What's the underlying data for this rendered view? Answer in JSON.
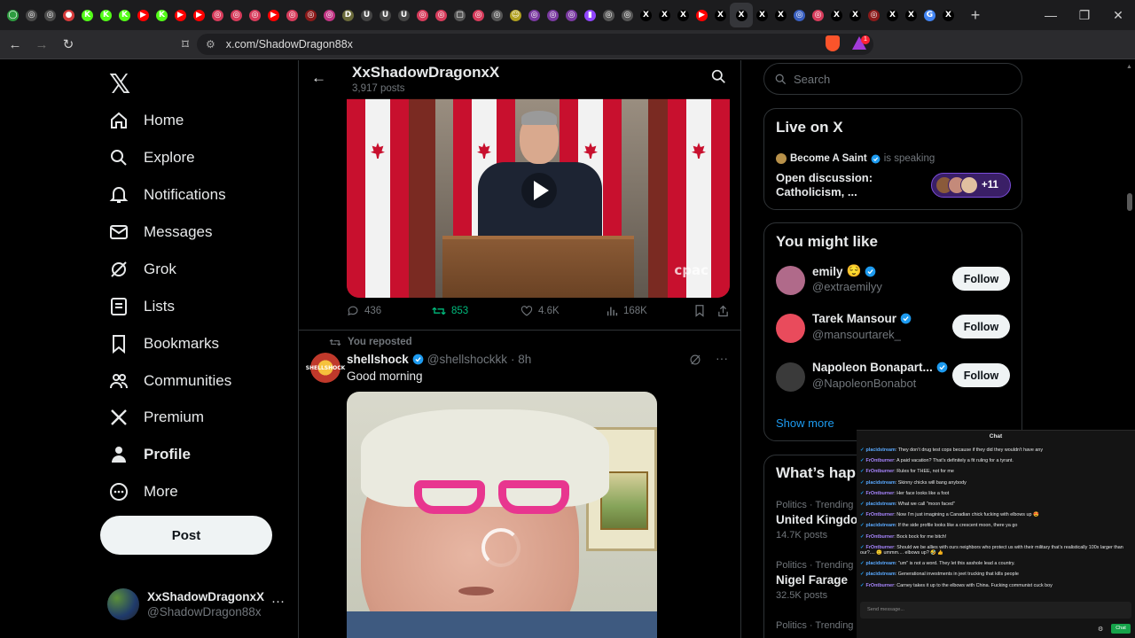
{
  "browser": {
    "tab_favicons": [
      {
        "color": "#2d9c3f",
        "glyph": "◯"
      },
      {
        "color": "#4a4a4a",
        "glyph": "◎"
      },
      {
        "color": "#4a4a4a",
        "glyph": "◎"
      },
      {
        "color": "#d63b3b",
        "glyph": "●"
      },
      {
        "color": "#53fc18",
        "glyph": "K"
      },
      {
        "color": "#53fc18",
        "glyph": "K"
      },
      {
        "color": "#53fc18",
        "glyph": "K"
      },
      {
        "color": "#ff0000",
        "glyph": "▶"
      },
      {
        "color": "#53fc18",
        "glyph": "K"
      },
      {
        "color": "#ff0000",
        "glyph": "▶"
      },
      {
        "color": "#ff0000",
        "glyph": "▶"
      },
      {
        "color": "#d63b5b",
        "glyph": "◎"
      },
      {
        "color": "#d63b5b",
        "glyph": "◎"
      },
      {
        "color": "#d63b5b",
        "glyph": "◎"
      },
      {
        "color": "#ff0000",
        "glyph": "▶"
      },
      {
        "color": "#d63b5b",
        "glyph": "◎"
      },
      {
        "color": "#8b1a1a",
        "glyph": "◎"
      },
      {
        "color": "#c13584",
        "glyph": "◎"
      },
      {
        "color": "#6a6a3a",
        "glyph": "D"
      },
      {
        "color": "#444",
        "glyph": "U"
      },
      {
        "color": "#444",
        "glyph": "U"
      },
      {
        "color": "#444",
        "glyph": "U"
      },
      {
        "color": "#d63b5b",
        "glyph": "◎"
      },
      {
        "color": "#d63b5b",
        "glyph": "◎"
      },
      {
        "color": "#555",
        "glyph": "▢"
      },
      {
        "color": "#d63b5b",
        "glyph": "◎"
      },
      {
        "color": "#555",
        "glyph": "◎"
      },
      {
        "color": "#b0a020",
        "glyph": "☺"
      },
      {
        "color": "#7a3aa0",
        "glyph": "◎"
      },
      {
        "color": "#7a3aa0",
        "glyph": "◎"
      },
      {
        "color": "#7a3aa0",
        "glyph": "◎"
      },
      {
        "color": "#9146ff",
        "glyph": "▮"
      },
      {
        "color": "#555",
        "glyph": "◎"
      },
      {
        "color": "#555",
        "glyph": "◎"
      },
      {
        "color": "#000",
        "glyph": "X"
      },
      {
        "color": "#000",
        "glyph": "X"
      },
      {
        "color": "#000",
        "glyph": "X"
      },
      {
        "color": "#ff0000",
        "glyph": "▶"
      },
      {
        "color": "#000",
        "glyph": "X"
      },
      {
        "color": "#000",
        "glyph": "X"
      },
      {
        "color": "#000",
        "glyph": "X"
      },
      {
        "color": "#000",
        "glyph": "X"
      },
      {
        "color": "#3a60c0",
        "glyph": "◎"
      },
      {
        "color": "#d63b5b",
        "glyph": "◎"
      },
      {
        "color": "#000",
        "glyph": "X"
      },
      {
        "color": "#000",
        "glyph": "X"
      },
      {
        "color": "#8b1a1a",
        "glyph": "◎"
      },
      {
        "color": "#000",
        "glyph": "X"
      },
      {
        "color": "#000",
        "glyph": "X"
      },
      {
        "color": "#4285f4",
        "glyph": "G"
      },
      {
        "color": "#000",
        "glyph": "X"
      }
    ],
    "active_tab_index": 39,
    "url": "x.com/ShadowDragon88x",
    "notif_badge": "1"
  },
  "nav": {
    "items": [
      {
        "label": "Home",
        "icon": "home-icon"
      },
      {
        "label": "Explore",
        "icon": "search-icon"
      },
      {
        "label": "Notifications",
        "icon": "bell-icon"
      },
      {
        "label": "Messages",
        "icon": "envelope-icon"
      },
      {
        "label": "Grok",
        "icon": "grok-icon"
      },
      {
        "label": "Lists",
        "icon": "list-icon"
      },
      {
        "label": "Bookmarks",
        "icon": "bookmark-icon"
      },
      {
        "label": "Communities",
        "icon": "people-icon"
      },
      {
        "label": "Premium",
        "icon": "x-icon"
      },
      {
        "label": "Profile",
        "icon": "person-icon"
      },
      {
        "label": "More",
        "icon": "more-circle-icon"
      }
    ],
    "post_label": "Post",
    "account": {
      "display_name": "XxShadowDragonxX",
      "handle": "@ShadowDragon88x"
    }
  },
  "profile_header": {
    "name": "XxShadowDragonxX",
    "posts": "3,917 posts"
  },
  "tweet1": {
    "video_watermark": "cpac",
    "replies": "436",
    "reposts": "853",
    "likes": "4.6K",
    "views": "168K"
  },
  "tweet2": {
    "repost_label": "You reposted",
    "name": "shellshock",
    "handle": "@shellshockkk",
    "time": "· 8h",
    "text": "Good morning",
    "avatar_text": "SHELLSHOCK"
  },
  "right": {
    "search_placeholder": "Search",
    "live": {
      "title": "Live on X",
      "host": "Become A Saint",
      "status": "is speaking",
      "topic": "Open discussion: Catholicism, ...",
      "listeners": "+11"
    },
    "might_like": {
      "title": "You might like",
      "people": [
        {
          "name": "emily",
          "handle": "@extraemilyy",
          "follow": "Follow",
          "extra": "😌",
          "avatar_color": "#b06a8a"
        },
        {
          "name": "Tarek Mansour",
          "handle": "@mansourtarek_",
          "follow": "Follow",
          "extra": "",
          "avatar_color": "#e94b5c"
        },
        {
          "name": "Napoleon Bonapart...",
          "handle": "@NapoleonBonabot",
          "follow": "Follow",
          "extra": "",
          "avatar_color": "#3a3a3a"
        }
      ],
      "show_more": "Show more"
    },
    "whats_happening": {
      "title": "What’s hap",
      "trends": [
        {
          "meta": "Politics · Trending",
          "title": "United Kingdon",
          "posts": "14.7K posts"
        },
        {
          "meta": "Politics · Trending",
          "title": "Nigel Farage",
          "posts": "32.5K posts"
        },
        {
          "meta": "Politics · Trending",
          "title": "",
          "posts": ""
        }
      ]
    }
  },
  "chat": {
    "title": "Chat",
    "messages": [
      {
        "user": "placidstream",
        "text": "They don’t drug test cops because if they did they wouldn’t have any"
      },
      {
        "user": "FrOntburner",
        "text": "A paid vacation? That’s definitely a fit ruling for a tyrant."
      },
      {
        "user": "FrOntburner",
        "text": "Rules for THEE, not for me"
      },
      {
        "user": "placidstream",
        "text": "Skinny chicks will bang anybody"
      },
      {
        "user": "FrOntburner",
        "text": "Her face looks like a foot"
      },
      {
        "user": "placidstream",
        "text": "What we call \"moon faced\""
      },
      {
        "user": "FrOntburner",
        "text": "Now I’m just imagining a Canadian chick fucking with elbows up 😍"
      },
      {
        "user": "placidstream",
        "text": "If the side profile looks like a crescent moon, there ya go"
      },
      {
        "user": "FrOntburner",
        "text": "Bock bock for me bitch!"
      },
      {
        "user": "FrOntburner",
        "text": "Should we be allies with ours neighbors who protect us with their military that’s realistically 100x larger than our?.... 😐 ummm.... elbows up? 🤣 👍"
      },
      {
        "user": "placidstream",
        "text": "\"um\" is not a word. They let this asshole lead a country."
      },
      {
        "user": "placidstream",
        "text": "Generational investments in jeet trucking that kills people"
      },
      {
        "user": "FrOntburner",
        "text": "Carney takes it up to the elbows with China. Fucking communist cuck boy"
      }
    ],
    "input_placeholder": "Send message...",
    "send_label": "Chat"
  }
}
